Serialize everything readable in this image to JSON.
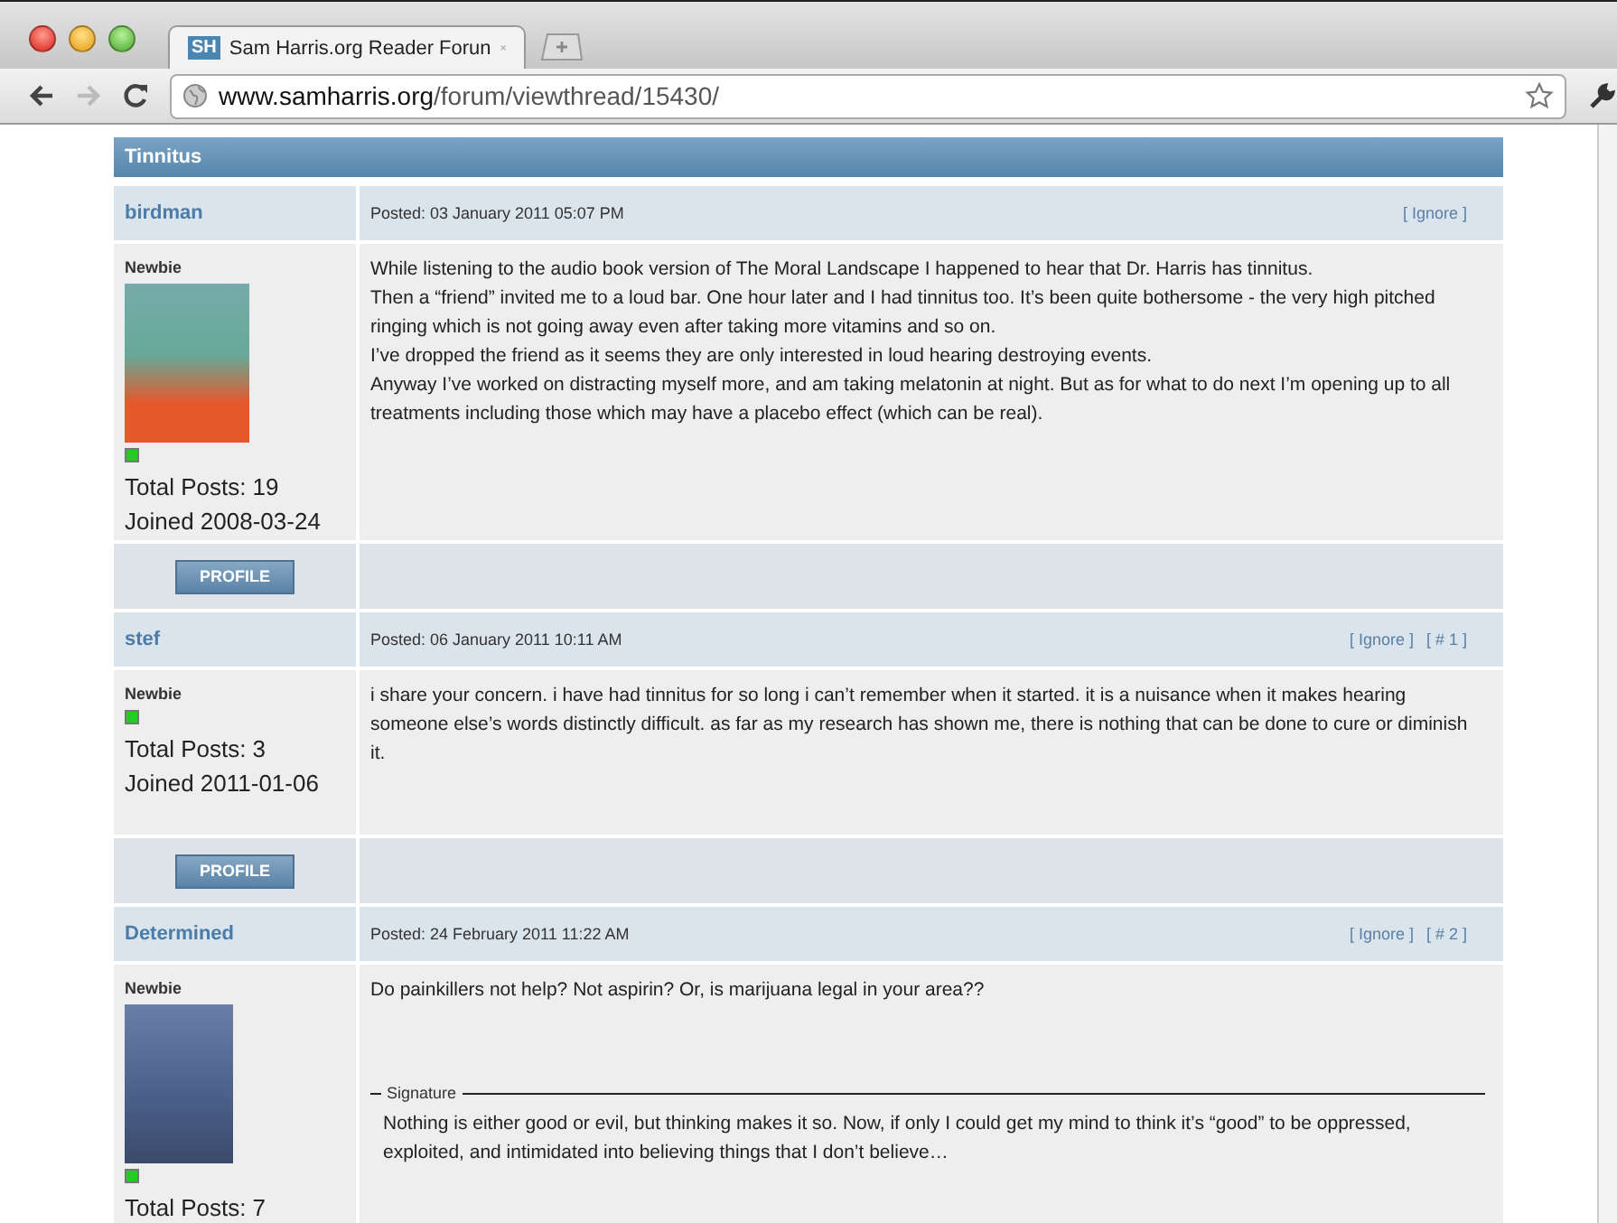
{
  "browser": {
    "tab": {
      "favicon": "SH",
      "title": "Sam Harris.org Reader Forun",
      "selected": true
    },
    "url": {
      "domain": "www.samharris.org",
      "path": "/forum/viewthread/15430/"
    }
  },
  "thread": {
    "title": "Tinnitus"
  },
  "posts": [
    {
      "author": "birdman",
      "posted": "Posted: 03 January 2011 05:07 PM",
      "actions": [
        "[ Ignore ]"
      ],
      "rank": "Newbie",
      "avatar": true,
      "online": true,
      "total_posts": "Total Posts:  19",
      "joined": "Joined  2008-03-24",
      "body": [
        "While listening to the audio book version of The Moral Landscape I happened to hear that Dr. Harris has tinnitus.",
        "Then a “friend” invited me to a loud bar. One hour later and I had tinnitus too. It’s been quite bothersome - the very high pitched ringing which is not going away even after taking more vitamins and so on.",
        "I’ve dropped the friend as it seems they are only interested in loud hearing destroying events.",
        "Anyway I’ve worked on distracting myself more, and am taking melatonin at night. But as for what to do next I’m opening up to all treatments including those which may have a placebo effect (which can be real)."
      ],
      "profile_button": "PROFILE"
    },
    {
      "author": "stef",
      "posted": "Posted: 06 January 2011 10:11 AM",
      "actions": [
        "[ Ignore ]",
        "[ # 1 ]"
      ],
      "rank": "Newbie",
      "avatar": false,
      "online": true,
      "total_posts": "Total Posts:  3",
      "joined": "Joined  2011-01-06",
      "body": [
        "i share your concern.  i have had tinnitus for so long i can’t remember when it started.  it is a nuisance when it makes hearing someone else’s words distinctly difficult.  as far as my research has shown me, there is nothing that can be done to cure or diminish it."
      ],
      "profile_button": "PROFILE"
    },
    {
      "author": "Determined",
      "posted": "Posted: 24 February 2011 11:22 AM",
      "actions": [
        "[ Ignore ]",
        "[ # 2 ]"
      ],
      "rank": "Newbie",
      "avatar": true,
      "online": true,
      "total_posts": "Total Posts:  7",
      "body": [
        "Do painkillers not help? Not aspirin? Or, is marijuana legal in your area??"
      ],
      "signature": {
        "label": "Signature",
        "text": "Nothing is either good or evil, but thinking makes it so. Now, if only I could get my mind to think it’s “good” to be oppressed, exploited, and intimidated into believing things that I don’t believe…"
      }
    }
  ]
}
